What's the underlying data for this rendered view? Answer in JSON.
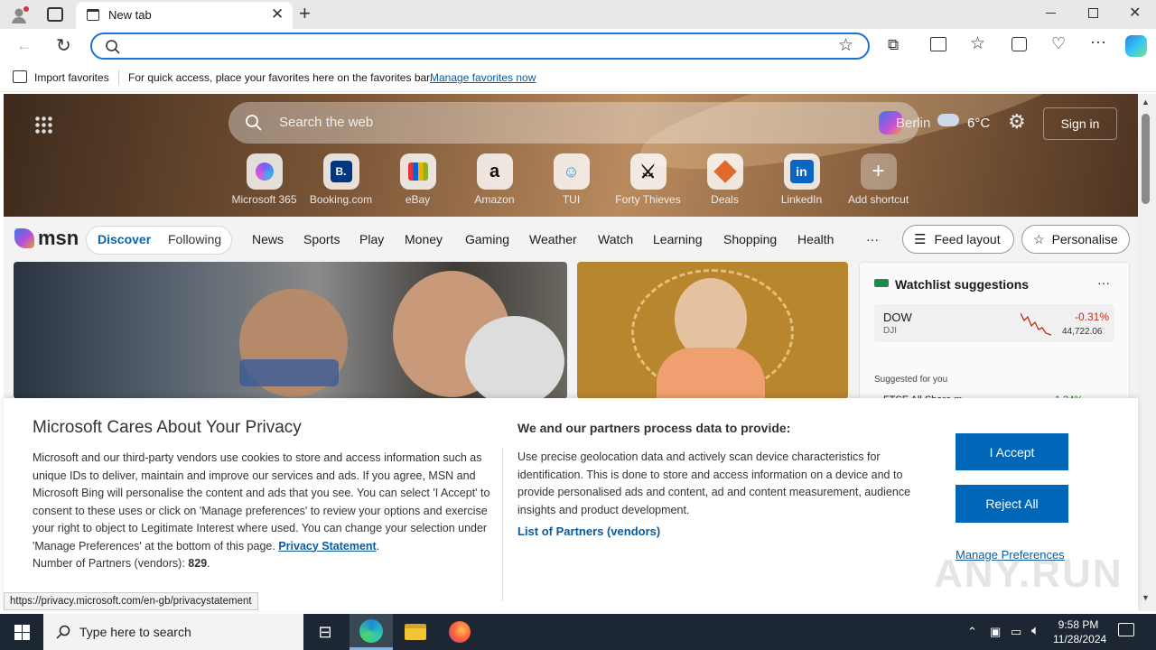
{
  "browser": {
    "tab_title": "New tab",
    "address_value": "",
    "favbar_import": "Import favorites",
    "favbar_hint": "For quick access, place your favorites here on the favorites bar.",
    "favbar_link": "Manage favorites now"
  },
  "msn": {
    "search_placeholder": "Search the web",
    "location": "Berlin",
    "temp": "6°C",
    "signin": "Sign in",
    "logo": "msn",
    "shortcuts": [
      {
        "label": "Microsoft 365",
        "icon": "microsoft365-icon"
      },
      {
        "label": "Booking.com",
        "icon": "booking-icon"
      },
      {
        "label": "eBay",
        "icon": "ebay-icon"
      },
      {
        "label": "Amazon",
        "icon": "amazon-icon"
      },
      {
        "label": "TUI",
        "icon": "tui-icon"
      },
      {
        "label": "Forty Thieves",
        "icon": "forty-thieves-icon"
      },
      {
        "label": "Deals",
        "icon": "deals-icon"
      },
      {
        "label": "LinkedIn",
        "icon": "linkedin-icon"
      },
      {
        "label": "Add shortcut",
        "icon": "plus-icon"
      }
    ],
    "tabs": {
      "discover": "Discover",
      "following": "Following"
    },
    "nav": [
      "News",
      "Sports",
      "Play",
      "Money",
      "Gaming",
      "Weather",
      "Watch",
      "Learning",
      "Shopping",
      "Health"
    ],
    "more": "···",
    "feed_layout": "Feed layout",
    "personalise": "Personalise",
    "watchlist": {
      "title": "Watchlist suggestions",
      "more": "···",
      "stock_name": "DOW",
      "stock_ticker": "DJI",
      "stock_change": "-0.31%",
      "stock_value": "44,722.06",
      "suggested": "Suggested for you",
      "next_name": "FTSE All Share m...",
      "next_change": "1.34%"
    }
  },
  "privacy": {
    "title": "Microsoft Cares About Your Privacy",
    "body": "Microsoft and our third-party vendors use cookies to store and access information such as unique IDs to deliver, maintain and improve our services and ads. If you agree, MSN and Microsoft Bing will personalise the content and ads that you see. You can select 'I Accept' to consent to these uses or click on 'Manage preferences' to review your options and exercise your right to object to Legitimate Interest where used.  You can change your selection under 'Manage Preferences' at the bottom of this page.",
    "statement_link": "Privacy Statement",
    "partners_label": "Number of Partners (vendors):",
    "partners_count": "829",
    "right_title": "We and our partners process data to provide:",
    "right_body": "Use precise geolocation data and actively scan device characteristics for identification. This is done to store and access information on a device and to provide personalised ads and content, ad and content measurement, audience insights and product development.",
    "partners_link": "List of Partners (vendors)",
    "accept": "I Accept",
    "reject": "Reject All",
    "manage": "Manage Preferences"
  },
  "status_url": "https://privacy.microsoft.com/en-gb/privacystatement",
  "taskbar": {
    "search_placeholder": "Type here to search",
    "time": "9:58 PM",
    "date": "11/28/2024"
  },
  "watermark": "ANY.RUN",
  "colors": {
    "accent": "#0067b8",
    "link": "#0a5a9c",
    "negative": "#c42b1c",
    "positive": "#107c10"
  }
}
